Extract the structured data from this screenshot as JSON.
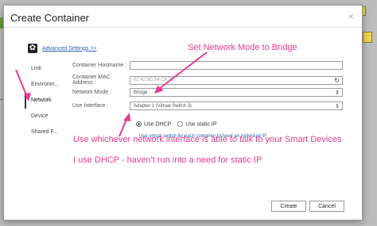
{
  "dialog": {
    "title": "Create Container",
    "close_label": "×",
    "advanced_settings_label": "Advanced Settings >>"
  },
  "sidebar": {
    "items": [
      {
        "label": "Link"
      },
      {
        "label": "Environm..."
      },
      {
        "label": "Network"
      },
      {
        "label": "Device"
      },
      {
        "label": "Shared F..."
      }
    ],
    "active_index": 2
  },
  "form": {
    "hostname": {
      "label": "Container Hostname :",
      "value": ""
    },
    "mac": {
      "label": "Container MAC Address :",
      "value": "02:42:3C:54:C6:7C"
    },
    "network_mode": {
      "label": "Network Mode :",
      "value": "Bridge"
    },
    "use_interface": {
      "label": "Use Interface :",
      "value": "Adapter 1 (Virtual Switch 3)"
    },
    "dhcp_label": "Use DHCP",
    "static_label": "Use static IP",
    "dhcp_selected": true,
    "hint": "Use virtual switch for each container to have an individual IP"
  },
  "buttons": {
    "create": "Create",
    "cancel": "Cancel"
  },
  "annotations": {
    "network_mode": "Set Network Mode to Bridge",
    "interface": "Use whichever network interface is able to talk to your Smart Devices",
    "dhcp": "I use DHCP - haven't run into a need for static IP"
  },
  "colors": {
    "annotation": "#e8398c",
    "link": "#2b5fae"
  },
  "icons": {
    "settings": "gear-icon",
    "refresh": "refresh-icon",
    "dropdown": "chevron-down-icon",
    "close": "close-icon"
  }
}
